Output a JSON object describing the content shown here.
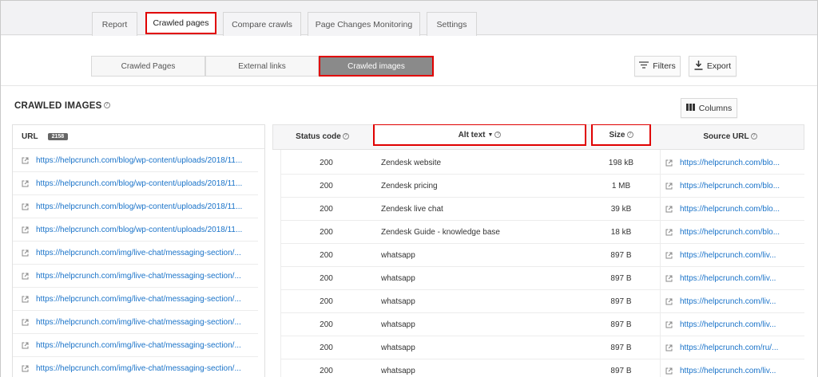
{
  "top_tabs": [
    "Report",
    "Crawled pages",
    "Compare crawls",
    "Page Changes Monitoring",
    "Settings"
  ],
  "sub_tabs": [
    "Crawled Pages",
    "External links",
    "Crawled images"
  ],
  "toolbar": {
    "filters_label": "Filters",
    "export_label": "Export",
    "columns_label": "Columns"
  },
  "section": {
    "title": "CRAWLED IMAGES"
  },
  "url_panel": {
    "header": "URL",
    "count": "2158",
    "urls": [
      "https://helpcrunch.com/blog/wp-content/uploads/2018/11...",
      "https://helpcrunch.com/blog/wp-content/uploads/2018/11...",
      "https://helpcrunch.com/blog/wp-content/uploads/2018/11...",
      "https://helpcrunch.com/blog/wp-content/uploads/2018/11...",
      "https://helpcrunch.com/img/live-chat/messaging-section/...",
      "https://helpcrunch.com/img/live-chat/messaging-section/...",
      "https://helpcrunch.com/img/live-chat/messaging-section/...",
      "https://helpcrunch.com/img/live-chat/messaging-section/...",
      "https://helpcrunch.com/img/live-chat/messaging-section/...",
      "https://helpcrunch.com/img/live-chat/messaging-section/..."
    ]
  },
  "table": {
    "headers": {
      "status": "Status code",
      "alt": "Alt text",
      "size": "Size",
      "source": "Source URL"
    },
    "rows": [
      {
        "status": "200",
        "alt": "Zendesk website",
        "size": "198 kB",
        "source": "https://helpcrunch.com/blo..."
      },
      {
        "status": "200",
        "alt": "Zendesk pricing",
        "size": "1 MB",
        "source": "https://helpcrunch.com/blo..."
      },
      {
        "status": "200",
        "alt": "Zendesk live chat",
        "size": "39 kB",
        "source": "https://helpcrunch.com/blo..."
      },
      {
        "status": "200",
        "alt": "Zendesk Guide - knowledge base",
        "size": "18 kB",
        "source": "https://helpcrunch.com/blo..."
      },
      {
        "status": "200",
        "alt": "whatsapp",
        "size": "897 B",
        "source": "https://helpcrunch.com/liv..."
      },
      {
        "status": "200",
        "alt": "whatsapp",
        "size": "897 B",
        "source": "https://helpcrunch.com/liv..."
      },
      {
        "status": "200",
        "alt": "whatsapp",
        "size": "897 B",
        "source": "https://helpcrunch.com/liv..."
      },
      {
        "status": "200",
        "alt": "whatsapp",
        "size": "897 B",
        "source": "https://helpcrunch.com/liv..."
      },
      {
        "status": "200",
        "alt": "whatsapp",
        "size": "897 B",
        "source": "https://helpcrunch.com/ru/..."
      },
      {
        "status": "200",
        "alt": "whatsapp",
        "size": "897 B",
        "source": "https://helpcrunch.com/liv..."
      }
    ]
  },
  "colors": {
    "highlight": "#e00000",
    "link": "#1a73c9",
    "active_segment": "#8a8a8a"
  }
}
